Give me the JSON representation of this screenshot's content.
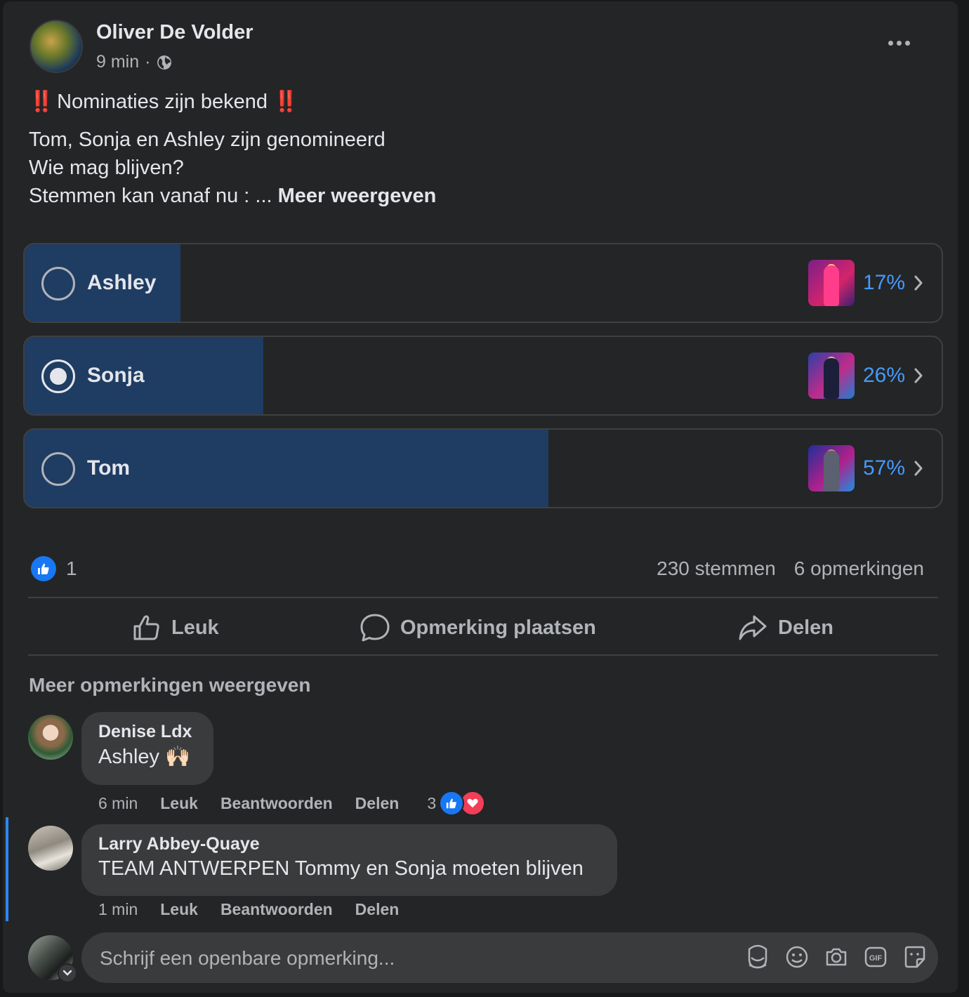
{
  "post": {
    "author": "Oliver De Volder",
    "time": "9 min",
    "separator": "·",
    "headline_marks_left": "‼️",
    "headline": "Nominaties zijn bekend",
    "headline_marks_right": "‼️",
    "body_lines": [
      "Tom, Sonja en Ashley zijn genomineerd",
      "Wie mag blijven?",
      "Stemmen kan vanaf nu : ..."
    ],
    "see_more": "Meer weergeven"
  },
  "poll": {
    "options": [
      {
        "label": "Ashley",
        "percent_text": "17%",
        "percent": 17,
        "selected": false
      },
      {
        "label": "Sonja",
        "percent_text": "26%",
        "percent": 26,
        "selected": true
      },
      {
        "label": "Tom",
        "percent_text": "57%",
        "percent": 57,
        "selected": false
      }
    ]
  },
  "stats": {
    "like_count": "1",
    "votes": "230 stemmen",
    "comments": "6 opmerkingen"
  },
  "actions": {
    "like": "Leuk",
    "comment": "Opmerking plaatsen",
    "share": "Delen"
  },
  "comments_section": {
    "more_comments": "Meer opmerkingen weergeven",
    "comments": [
      {
        "author": "Denise Ldx",
        "text": "Ashley 🙌🏻",
        "time": "6 min",
        "like": "Leuk",
        "reply": "Beantwoorden",
        "share": "Delen",
        "reaction_count": "3"
      },
      {
        "author": "Larry Abbey-Quaye",
        "text": "TEAM ANTWERPEN Tommy en Sonja moeten blijven",
        "time": "1 min",
        "like": "Leuk",
        "reply": "Beantwoorden",
        "share": "Delen"
      }
    ],
    "input_placeholder": "Schrijf een openbare opmerking..."
  },
  "colors": {
    "card_bg": "#242526",
    "poll_fill": "#1f3c63",
    "accent_blue": "#4599ff",
    "like_blue": "#1877f2",
    "love_red": "#f33e58"
  },
  "icons": [
    "globe-icon",
    "more-icon",
    "like-icon",
    "comment-icon",
    "share-icon",
    "chevron-right-icon",
    "avatar-sticker-icon",
    "emoji-icon",
    "camera-icon",
    "gif-icon",
    "sticker-icon",
    "heart-icon",
    "chevron-down-icon"
  ]
}
